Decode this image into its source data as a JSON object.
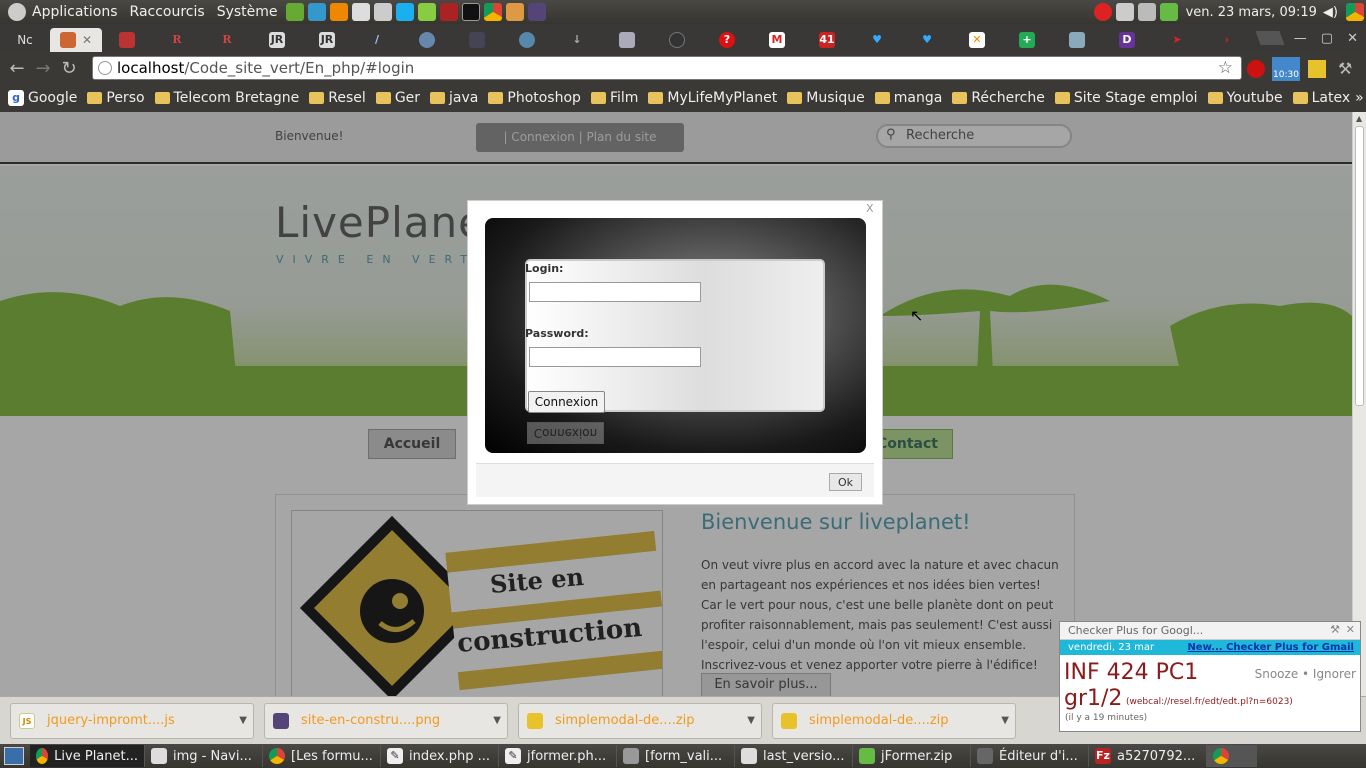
{
  "topbar": {
    "menus": [
      "Applications",
      "Raccourcis",
      "Système"
    ],
    "clock": "ven. 23 mars, 09:19"
  },
  "tabs": [
    {
      "label": "Nc",
      "icon": "tab-icon"
    },
    {
      "label": "",
      "icon": "tab-icon"
    }
  ],
  "address": {
    "host": "localhost",
    "path": "/Code_site_vert/En_php/#login"
  },
  "bookmarks": [
    "Google",
    "Perso",
    "Telecom Bretagne",
    "Resel",
    "Ger",
    "java",
    "Photoshop",
    "Film",
    "MyLifeMyPlanet",
    "Musique",
    "manga",
    "Récherche",
    "Site Stage emploi",
    "Youtube",
    "Latex"
  ],
  "page": {
    "welcome": "Bienvenue!",
    "connexion_bar": "| Connexion | Plan du site",
    "search_placeholder": "Recherche",
    "logo": "LivePlanet",
    "tagline": "VIVRE EN VERT",
    "nav": {
      "home": "Accueil",
      "contact": "Contact"
    },
    "construction_line1": "Site en",
    "construction_line2": "construction",
    "heading": "Bienvenue sur liveplanet!",
    "body": "On veut vivre plus en accord avec la nature et avec chacun en partageant nos expériences et nos idées bien vertes! Car le vert pour nous, c'est une belle planète dont on peut profiter raisonnablement, mais pas seulement! C'est aussi l'espoir, celui d'un monde où l'on vit mieux ensemble. Inscrivez-vous et venez apporter votre pierre à l'édifice!",
    "more": "En savoir plus..."
  },
  "modal": {
    "close": "X",
    "login_label": "Login:",
    "password_label": "Password:",
    "submit": "Connexion",
    "reflection": "Connexion",
    "ok": "Ok"
  },
  "downloads": [
    {
      "name": "jquery-impromt....js",
      "type": "JS"
    },
    {
      "name": "site-en-constru....png",
      "type": "png"
    },
    {
      "name": "simplemodal-de....zip",
      "type": "zip"
    },
    {
      "name": "simplemodal-de....zip",
      "type": "zip"
    }
  ],
  "checker": {
    "title": "Checker Plus for Googl...",
    "date": "vendredi, 23 mar",
    "link": "New... Checker Plus for Gmail",
    "event1": "INF 424 PC1",
    "event2": "gr1/2",
    "event_url": "(webcal://resel.fr/edt/edt.pl?n=6023)",
    "snooze": "Snooze • Ignorer",
    "ago": "(il y a 19 minutes)"
  },
  "taskbar": [
    "Live Planet...",
    "img - Navi...",
    "[Les formu...",
    "index.php ...",
    "jformer.ph...",
    "[form_vali...",
    "last_versio...",
    "jFormer.zip",
    "Éditeur d'i...",
    "a5270792..."
  ],
  "colors": {
    "green": "#7fbf3e",
    "teal": "#5aa6b8",
    "download_orange": "#f09a20",
    "checker_bar": "#20b8d8",
    "event_red": "#8b1a1a"
  }
}
